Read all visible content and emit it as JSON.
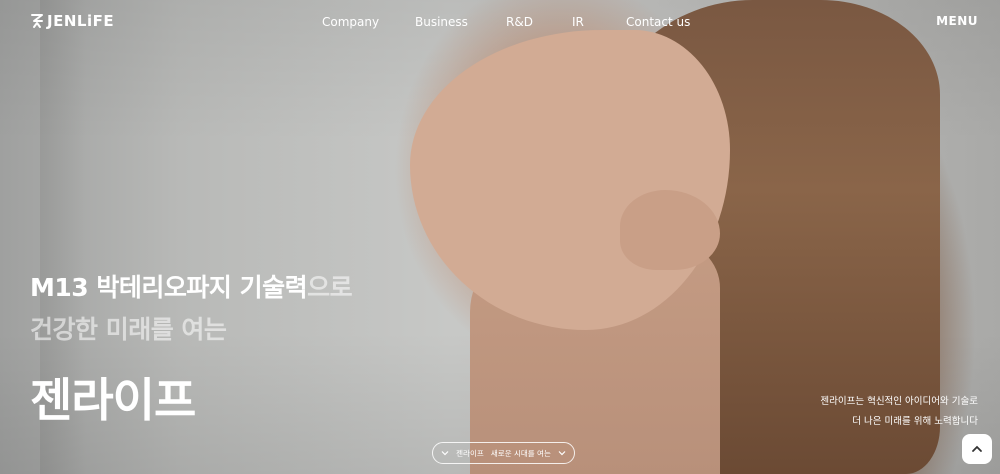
{
  "header": {
    "logo_text": "JENLiFE",
    "nav": [
      "Company",
      "Business",
      "R&D",
      "IR",
      "Contact us"
    ],
    "menu_label": "MENU"
  },
  "hero": {
    "headline_strong": "M13 박테리오파지 기술력",
    "headline_fade": "으로",
    "subheadline": "건강한 미래를 여는",
    "brand_korean": "젠라이프",
    "description_line1": "젠라이프는 혁신적인 아이디어와 기술로",
    "description_line2": "더 나은 미래를 위해 노력합니다",
    "scroll_left": "젠라이프",
    "scroll_right": "새로운 시대를 여는"
  },
  "icons": {
    "logo": "jenlife-logo-icon",
    "scroll_chevron": "chevron-down-icon",
    "top_button": "chevron-up-icon"
  },
  "colors": {
    "text": "#ffffff",
    "hair": "#7a5842",
    "skin": "#d2ab94",
    "background": "#bcbdbc"
  }
}
